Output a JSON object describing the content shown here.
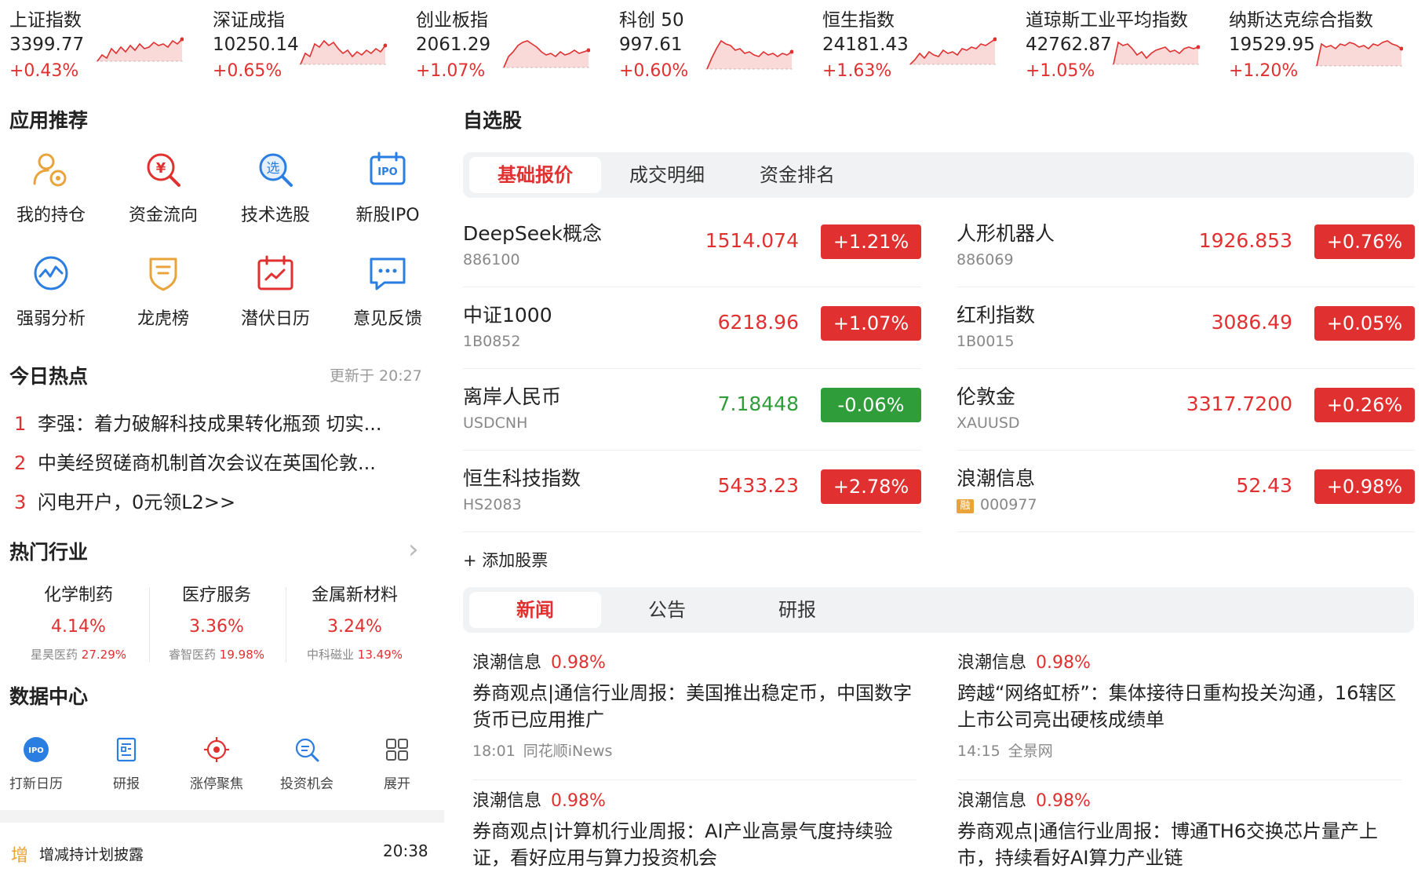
{
  "indices": [
    {
      "name": "上证指数",
      "value": "3399.77",
      "change": "+0.43%",
      "line": [
        30,
        22,
        26,
        14,
        20,
        12,
        18,
        10,
        16,
        8,
        14,
        12,
        6,
        10,
        8,
        12,
        4,
        8,
        2
      ]
    },
    {
      "name": "深证成指",
      "value": "10250.14",
      "change": "+0.65%",
      "line": [
        34,
        20,
        24,
        8,
        12,
        4,
        10,
        6,
        14,
        20,
        16,
        24,
        18,
        22,
        16,
        20,
        14,
        18,
        10
      ]
    },
    {
      "name": "创业板指",
      "value": "2061.29",
      "change": "+1.07%",
      "line": [
        38,
        24,
        18,
        10,
        6,
        4,
        8,
        12,
        18,
        22,
        20,
        24,
        18,
        22,
        20,
        16,
        20,
        18,
        16
      ]
    },
    {
      "name": "科创 50",
      "value": "997.61",
      "change": "+0.60%",
      "line": [
        40,
        26,
        14,
        4,
        8,
        10,
        16,
        14,
        20,
        18,
        22,
        24,
        18,
        22,
        20,
        24,
        20,
        22,
        18
      ]
    },
    {
      "name": "恒生指数",
      "value": "24181.43",
      "change": "+1.63%",
      "line": [
        34,
        28,
        20,
        26,
        18,
        22,
        24,
        16,
        20,
        18,
        22,
        14,
        16,
        12,
        14,
        8,
        10,
        6,
        2
      ]
    },
    {
      "name": "道琼斯工业平均指数",
      "value": "42762.87",
      "change": "+1.05%",
      "line": [
        34,
        6,
        10,
        8,
        14,
        22,
        18,
        26,
        20,
        16,
        14,
        12,
        18,
        16,
        20,
        14,
        12,
        14,
        12
      ]
    },
    {
      "name": "纳斯达克综合指数",
      "value": "19529.95",
      "change": "+1.20%",
      "line": [
        36,
        8,
        12,
        10,
        14,
        8,
        10,
        6,
        8,
        12,
        10,
        14,
        8,
        10,
        6,
        4,
        8,
        10,
        14
      ]
    }
  ],
  "apps": {
    "title": "应用推荐",
    "items": [
      {
        "label": "我的持仓",
        "icon": "holdings-icon"
      },
      {
        "label": "资金流向",
        "icon": "money-flow-icon"
      },
      {
        "label": "技术选股",
        "icon": "stock-picker-icon"
      },
      {
        "label": "新股IPO",
        "icon": "ipo-icon",
        "icon_text": "IPO"
      },
      {
        "label": "强弱分析",
        "icon": "strength-analysis-icon"
      },
      {
        "label": "龙虎榜",
        "icon": "dragon-tiger-icon"
      },
      {
        "label": "潜伏日历",
        "icon": "calendar-icon"
      },
      {
        "label": "意见反馈",
        "icon": "feedback-icon"
      }
    ],
    "picker_glyph": "选",
    "money_glyph": "¥"
  },
  "hot": {
    "title": "今日热点",
    "updated": "更新于 20:27",
    "items": [
      {
        "rank": "1",
        "text": "李强：着力破解科技成果转化瓶颈 切实..."
      },
      {
        "rank": "2",
        "text": "中美经贸磋商机制首次会议在英国伦敦..."
      },
      {
        "rank": "3",
        "text": "闪电开户，0元领L2>>"
      }
    ]
  },
  "industries": {
    "title": "热门行业",
    "more_glyph": "›",
    "items": [
      {
        "name": "化学制药",
        "change": "4.14%",
        "leader": "星昊医药",
        "leader_change": "27.29%"
      },
      {
        "name": "医疗服务",
        "change": "3.36%",
        "leader": "睿智医药",
        "leader_change": "19.98%"
      },
      {
        "name": "金属新材料",
        "change": "3.24%",
        "leader": "中科磁业",
        "leader_change": "13.49%"
      }
    ]
  },
  "data_center": {
    "title": "数据中心",
    "items": [
      {
        "label": "打新日历",
        "icon": "ipo-calendar-icon",
        "icon_text": "IPO"
      },
      {
        "label": "研报",
        "icon": "research-report-icon"
      },
      {
        "label": "涨停聚焦",
        "icon": "limit-up-focus-icon"
      },
      {
        "label": "投资机会",
        "icon": "investment-opportunity-icon"
      },
      {
        "label": "展开",
        "icon": "expand-grid-icon"
      }
    ]
  },
  "notice": {
    "tag": "增",
    "text": "增减持计划披露",
    "time": "20:38"
  },
  "watchlist": {
    "title": "自选股",
    "tabs": [
      "基础报价",
      "成交明细",
      "资金排名"
    ],
    "active_tab": 0,
    "stocks": [
      {
        "name": "DeepSeek概念",
        "code": "886100",
        "price": "1514.074",
        "change": "+1.21%",
        "dir": "up"
      },
      {
        "name": "人形机器人",
        "code": "886069",
        "price": "1926.853",
        "change": "+0.76%",
        "dir": "up"
      },
      {
        "name": "中证1000",
        "code": "1B0852",
        "price": "6218.96",
        "change": "+1.07%",
        "dir": "up"
      },
      {
        "name": "红利指数",
        "code": "1B0015",
        "price": "3086.49",
        "change": "+0.05%",
        "dir": "up"
      },
      {
        "name": "离岸人民币",
        "code": "USDCNH",
        "price": "7.18448",
        "change": "-0.06%",
        "dir": "down"
      },
      {
        "name": "伦敦金",
        "code": "XAUUSD",
        "price": "3317.7200",
        "change": "+0.26%",
        "dir": "up"
      },
      {
        "name": "恒生科技指数",
        "code": "HS2083",
        "price": "5433.23",
        "change": "+2.78%",
        "dir": "up"
      },
      {
        "name": "浪潮信息",
        "code": "000977",
        "price": "52.43",
        "change": "+0.98%",
        "dir": "up",
        "tag": "融"
      }
    ],
    "add_label": "+ 添加股票"
  },
  "news_section": {
    "tabs": [
      "新闻",
      "公告",
      "研报"
    ],
    "active_tab": 0,
    "items": [
      {
        "stock": "浪潮信息",
        "change": "0.98%",
        "title": "券商观点|通信行业周报：美国推出稳定币，中国数字货币已应用推广",
        "time": "18:01",
        "source": "同花顺iNews"
      },
      {
        "stock": "浪潮信息",
        "change": "0.98%",
        "title": "跨越“网络虹桥”：集体接待日重构投关沟通，16辖区上市公司亮出硬核成绩单",
        "time": "14:15",
        "source": "全景网"
      },
      {
        "stock": "浪潮信息",
        "change": "0.98%",
        "title": "券商观点|计算机行业周报：AI产业高景气度持续验证，看好应用与算力投资机会",
        "time": "",
        "source": ""
      },
      {
        "stock": "浪潮信息",
        "change": "0.98%",
        "title": "券商观点|通信行业周报：博通TH6交换芯片量产上市，持续看好AI算力产业链",
        "time": "",
        "source": ""
      }
    ]
  },
  "colors": {
    "up": "#e0302f",
    "down": "#2f9e3a",
    "accent": "#e8a33b",
    "blue": "#2a7de1"
  }
}
